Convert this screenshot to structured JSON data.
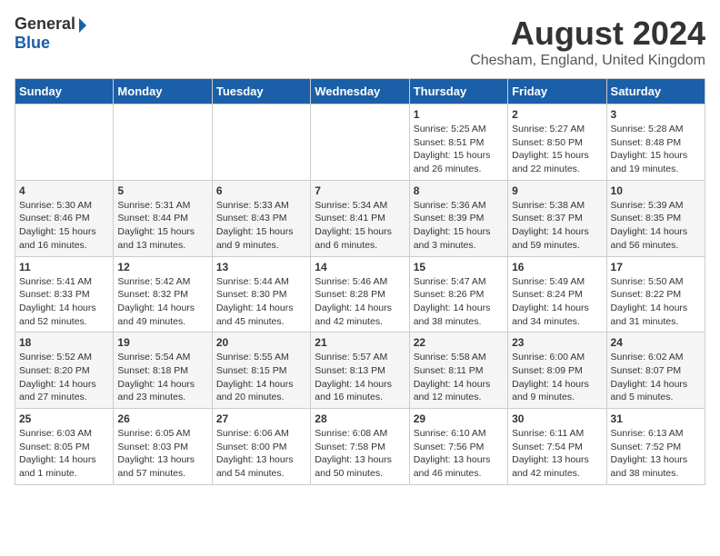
{
  "header": {
    "logo_general": "General",
    "logo_blue": "Blue",
    "title": "August 2024",
    "location": "Chesham, England, United Kingdom"
  },
  "columns": [
    "Sunday",
    "Monday",
    "Tuesday",
    "Wednesday",
    "Thursday",
    "Friday",
    "Saturday"
  ],
  "weeks": [
    [
      {
        "day": "",
        "info": ""
      },
      {
        "day": "",
        "info": ""
      },
      {
        "day": "",
        "info": ""
      },
      {
        "day": "",
        "info": ""
      },
      {
        "day": "1",
        "info": "Sunrise: 5:25 AM\nSunset: 8:51 PM\nDaylight: 15 hours\nand 26 minutes."
      },
      {
        "day": "2",
        "info": "Sunrise: 5:27 AM\nSunset: 8:50 PM\nDaylight: 15 hours\nand 22 minutes."
      },
      {
        "day": "3",
        "info": "Sunrise: 5:28 AM\nSunset: 8:48 PM\nDaylight: 15 hours\nand 19 minutes."
      }
    ],
    [
      {
        "day": "4",
        "info": "Sunrise: 5:30 AM\nSunset: 8:46 PM\nDaylight: 15 hours\nand 16 minutes."
      },
      {
        "day": "5",
        "info": "Sunrise: 5:31 AM\nSunset: 8:44 PM\nDaylight: 15 hours\nand 13 minutes."
      },
      {
        "day": "6",
        "info": "Sunrise: 5:33 AM\nSunset: 8:43 PM\nDaylight: 15 hours\nand 9 minutes."
      },
      {
        "day": "7",
        "info": "Sunrise: 5:34 AM\nSunset: 8:41 PM\nDaylight: 15 hours\nand 6 minutes."
      },
      {
        "day": "8",
        "info": "Sunrise: 5:36 AM\nSunset: 8:39 PM\nDaylight: 15 hours\nand 3 minutes."
      },
      {
        "day": "9",
        "info": "Sunrise: 5:38 AM\nSunset: 8:37 PM\nDaylight: 14 hours\nand 59 minutes."
      },
      {
        "day": "10",
        "info": "Sunrise: 5:39 AM\nSunset: 8:35 PM\nDaylight: 14 hours\nand 56 minutes."
      }
    ],
    [
      {
        "day": "11",
        "info": "Sunrise: 5:41 AM\nSunset: 8:33 PM\nDaylight: 14 hours\nand 52 minutes."
      },
      {
        "day": "12",
        "info": "Sunrise: 5:42 AM\nSunset: 8:32 PM\nDaylight: 14 hours\nand 49 minutes."
      },
      {
        "day": "13",
        "info": "Sunrise: 5:44 AM\nSunset: 8:30 PM\nDaylight: 14 hours\nand 45 minutes."
      },
      {
        "day": "14",
        "info": "Sunrise: 5:46 AM\nSunset: 8:28 PM\nDaylight: 14 hours\nand 42 minutes."
      },
      {
        "day": "15",
        "info": "Sunrise: 5:47 AM\nSunset: 8:26 PM\nDaylight: 14 hours\nand 38 minutes."
      },
      {
        "day": "16",
        "info": "Sunrise: 5:49 AM\nSunset: 8:24 PM\nDaylight: 14 hours\nand 34 minutes."
      },
      {
        "day": "17",
        "info": "Sunrise: 5:50 AM\nSunset: 8:22 PM\nDaylight: 14 hours\nand 31 minutes."
      }
    ],
    [
      {
        "day": "18",
        "info": "Sunrise: 5:52 AM\nSunset: 8:20 PM\nDaylight: 14 hours\nand 27 minutes."
      },
      {
        "day": "19",
        "info": "Sunrise: 5:54 AM\nSunset: 8:18 PM\nDaylight: 14 hours\nand 23 minutes."
      },
      {
        "day": "20",
        "info": "Sunrise: 5:55 AM\nSunset: 8:15 PM\nDaylight: 14 hours\nand 20 minutes."
      },
      {
        "day": "21",
        "info": "Sunrise: 5:57 AM\nSunset: 8:13 PM\nDaylight: 14 hours\nand 16 minutes."
      },
      {
        "day": "22",
        "info": "Sunrise: 5:58 AM\nSunset: 8:11 PM\nDaylight: 14 hours\nand 12 minutes."
      },
      {
        "day": "23",
        "info": "Sunrise: 6:00 AM\nSunset: 8:09 PM\nDaylight: 14 hours\nand 9 minutes."
      },
      {
        "day": "24",
        "info": "Sunrise: 6:02 AM\nSunset: 8:07 PM\nDaylight: 14 hours\nand 5 minutes."
      }
    ],
    [
      {
        "day": "25",
        "info": "Sunrise: 6:03 AM\nSunset: 8:05 PM\nDaylight: 14 hours\nand 1 minute."
      },
      {
        "day": "26",
        "info": "Sunrise: 6:05 AM\nSunset: 8:03 PM\nDaylight: 13 hours\nand 57 minutes."
      },
      {
        "day": "27",
        "info": "Sunrise: 6:06 AM\nSunset: 8:00 PM\nDaylight: 13 hours\nand 54 minutes."
      },
      {
        "day": "28",
        "info": "Sunrise: 6:08 AM\nSunset: 7:58 PM\nDaylight: 13 hours\nand 50 minutes."
      },
      {
        "day": "29",
        "info": "Sunrise: 6:10 AM\nSunset: 7:56 PM\nDaylight: 13 hours\nand 46 minutes."
      },
      {
        "day": "30",
        "info": "Sunrise: 6:11 AM\nSunset: 7:54 PM\nDaylight: 13 hours\nand 42 minutes."
      },
      {
        "day": "31",
        "info": "Sunrise: 6:13 AM\nSunset: 7:52 PM\nDaylight: 13 hours\nand 38 minutes."
      }
    ]
  ]
}
